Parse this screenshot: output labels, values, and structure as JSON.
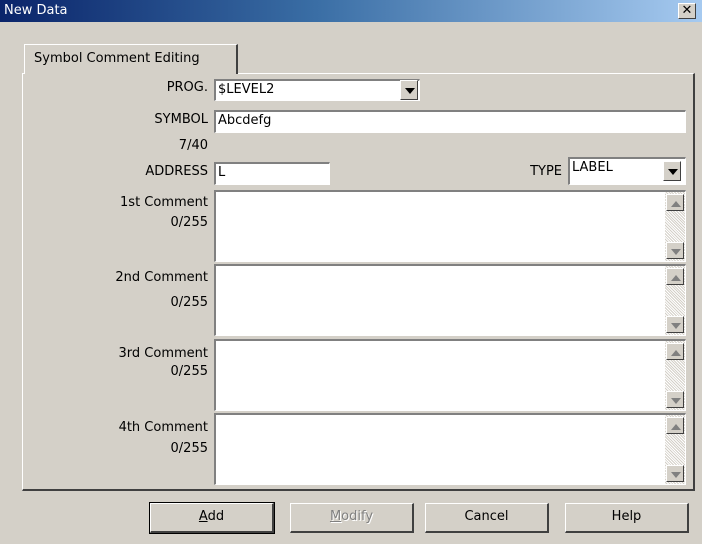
{
  "window": {
    "title": "New Data",
    "close_glyph": "✕"
  },
  "tab": {
    "label": "Symbol Comment Editing"
  },
  "form": {
    "prog_label": "PROG.",
    "prog_value": "$LEVEL2",
    "symbol_label": "SYMBOL",
    "symbol_value": "Abcdefg",
    "symbol_count": "7/40",
    "address_label": "ADDRESS",
    "address_value": "L",
    "type_label": "TYPE",
    "type_value": "LABEL",
    "comments": [
      {
        "label": "1st Comment",
        "count": "0/255",
        "value": ""
      },
      {
        "label": "2nd Comment",
        "count": "0/255",
        "value": ""
      },
      {
        "label": "3rd Comment",
        "count": "0/255",
        "value": ""
      },
      {
        "label": "4th Comment",
        "count": "0/255",
        "value": ""
      }
    ]
  },
  "buttons": {
    "add_mnemonic": "A",
    "add_rest": "dd",
    "modify_mnemonic": "M",
    "modify_rest": "odify",
    "cancel": "Cancel",
    "help": "Help"
  }
}
